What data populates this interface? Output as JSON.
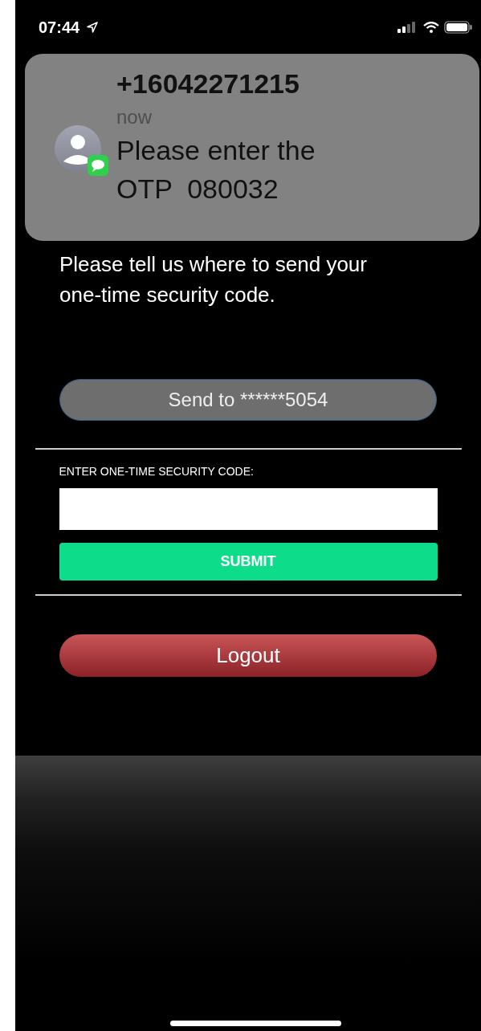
{
  "status_bar": {
    "time": "07:44"
  },
  "notification": {
    "sender": "+16042271215",
    "time": "now",
    "message": "Please enter the OTP  080032"
  },
  "instructions": "Please tell us where to send your one-time security code.",
  "send_button": "Send to ******5054",
  "code_field": {
    "label": "ENTER ONE-TIME SECURITY CODE:"
  },
  "submit_button": "SUBMIT",
  "logout_button": "Logout"
}
